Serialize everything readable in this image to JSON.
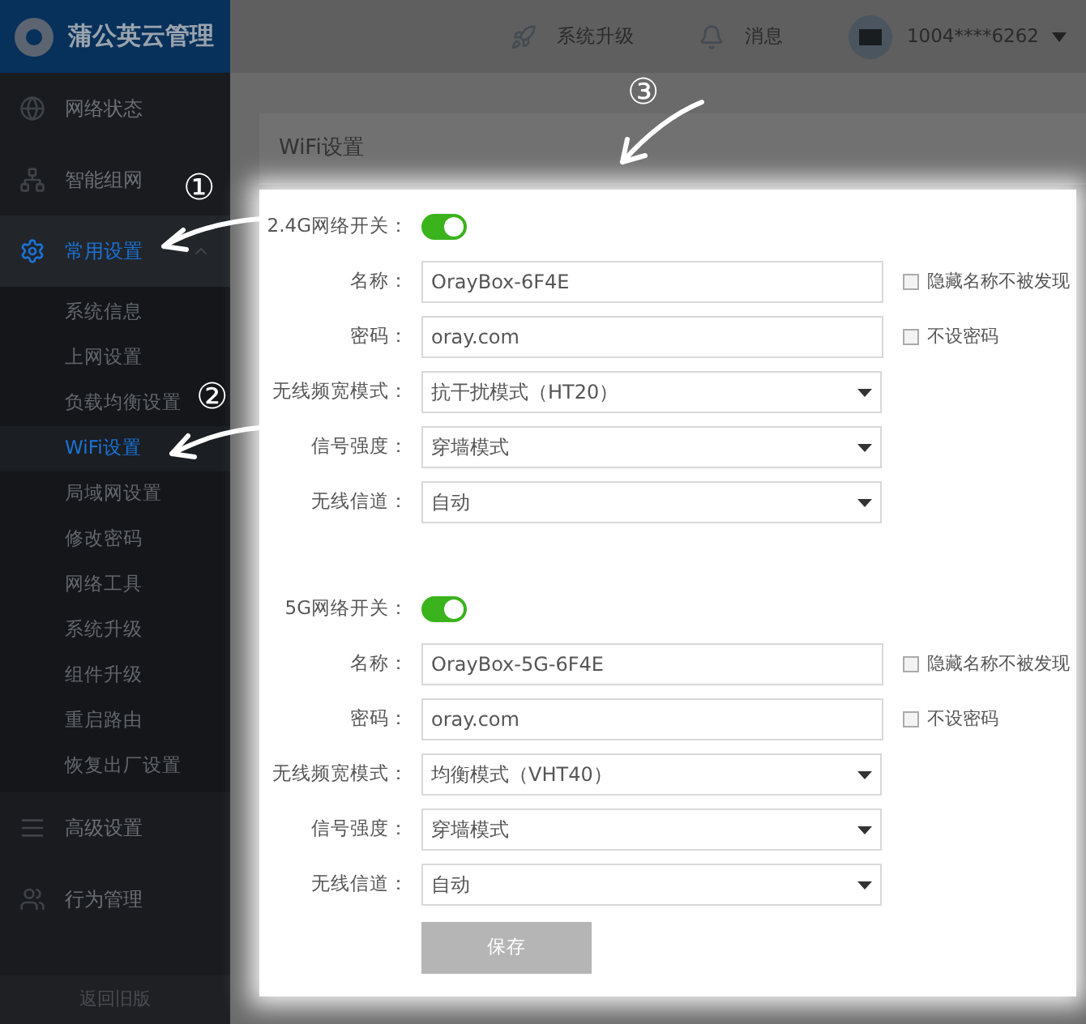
{
  "app": {
    "title": "蒲公英云管理"
  },
  "header": {
    "items": [
      {
        "label": "系统升级"
      },
      {
        "label": "消息"
      }
    ],
    "user": "1004****6262"
  },
  "sidebar": {
    "items": [
      {
        "label": "网络状态",
        "selected": false
      },
      {
        "label": "智能组网",
        "selected": false
      },
      {
        "label": "常用设置",
        "selected": true,
        "expanded": true,
        "children": [
          {
            "label": "系统信息",
            "selected": false
          },
          {
            "label": "上网设置",
            "selected": false
          },
          {
            "label": "负载均衡设置",
            "selected": false
          },
          {
            "label": "WiFi设置",
            "selected": true
          },
          {
            "label": "局域网设置",
            "selected": false
          },
          {
            "label": "修改密码",
            "selected": false
          },
          {
            "label": "网络工具",
            "selected": false
          },
          {
            "label": "系统升级",
            "selected": false
          },
          {
            "label": "组件升级",
            "selected": false
          },
          {
            "label": "重启路由",
            "selected": false
          },
          {
            "label": "恢复出厂设置",
            "selected": false
          }
        ]
      },
      {
        "label": "高级设置",
        "selected": false
      },
      {
        "label": "行为管理",
        "selected": false
      }
    ],
    "footer": "返回旧版"
  },
  "panel": {
    "title": "WiFi设置",
    "sections": [
      {
        "switch_label": "2.4G网络开关：",
        "on": true,
        "fields": [
          {
            "kind": "text",
            "label": "名称：",
            "value": "OrayBox-6F4E",
            "checkbox": {
              "label": "隐藏名称不被发现",
              "checked": false
            }
          },
          {
            "kind": "text",
            "label": "密码：",
            "value": "oray.com",
            "checkbox": {
              "label": "不设密码",
              "checked": false
            }
          },
          {
            "kind": "select",
            "label": "无线频宽模式：",
            "value": "抗干扰模式（HT20）"
          },
          {
            "kind": "select",
            "label": "信号强度：",
            "value": "穿墙模式"
          },
          {
            "kind": "select",
            "label": "无线信道：",
            "value": "自动"
          }
        ]
      },
      {
        "switch_label": "5G网络开关：",
        "on": true,
        "fields": [
          {
            "kind": "text",
            "label": "名称：",
            "value": "OrayBox-5G-6F4E",
            "checkbox": {
              "label": "隐藏名称不被发现",
              "checked": false
            }
          },
          {
            "kind": "text",
            "label": "密码：",
            "value": "oray.com",
            "checkbox": {
              "label": "不设密码",
              "checked": false
            }
          },
          {
            "kind": "select",
            "label": "无线频宽模式：",
            "value": "均衡模式（VHT40）"
          },
          {
            "kind": "select",
            "label": "信号强度：",
            "value": "穿墙模式"
          },
          {
            "kind": "select",
            "label": "无线信道：",
            "value": "自动"
          }
        ]
      }
    ],
    "save": {
      "label": "保存",
      "disabled": true
    }
  },
  "annotations": [
    "①",
    "②",
    "③"
  ]
}
